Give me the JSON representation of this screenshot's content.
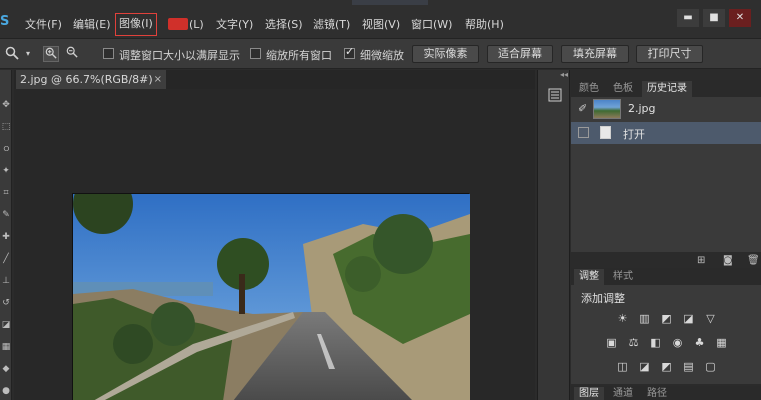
{
  "app": {
    "logo": "S"
  },
  "menubar": {
    "items": [
      {
        "label": "文件(F)"
      },
      {
        "label": "编辑(E)"
      },
      {
        "label": "图像(I)"
      },
      {
        "label": "(L)"
      },
      {
        "label": "文字(Y)"
      },
      {
        "label": "选择(S)"
      },
      {
        "label": "滤镜(T)"
      },
      {
        "label": "视图(V)"
      },
      {
        "label": "窗口(W)"
      },
      {
        "label": "帮助(H)"
      }
    ],
    "window_controls": {
      "minimize": "▬",
      "maximize": "■",
      "close": "✕"
    }
  },
  "options": {
    "zoom_icon": "search-icon",
    "checkbox1_label": "调整窗口大小以满屏显示",
    "checkbox1_checked": false,
    "checkbox2_label": "缩放所有窗口",
    "checkbox2_checked": false,
    "checkbox3_label": "细微缩放",
    "checkbox3_checked": true,
    "btn_actual": "实际像素",
    "btn_fit": "适合屏幕",
    "btn_fill": "填充屏幕",
    "btn_print": "打印尺寸"
  },
  "document": {
    "tab_title": "2.jpg @ 66.7%(RGB/8#)",
    "close": "×"
  },
  "history_panel": {
    "tabs": [
      {
        "label": "颜色"
      },
      {
        "label": "色板"
      },
      {
        "label": "历史记录"
      }
    ],
    "snapshot_label": "2.jpg",
    "step_label": "打开"
  },
  "adjustments_panel": {
    "tabs": [
      {
        "label": "调整"
      },
      {
        "label": "样式"
      }
    ],
    "title": "添加调整"
  },
  "layers_panel": {
    "tabs": [
      {
        "label": "图层"
      },
      {
        "label": "通道"
      },
      {
        "label": "路径"
      }
    ]
  },
  "colors": {
    "highlight_border": "#e0413b",
    "selection": "#4d5a6c",
    "accent": "#4aa8e0"
  }
}
